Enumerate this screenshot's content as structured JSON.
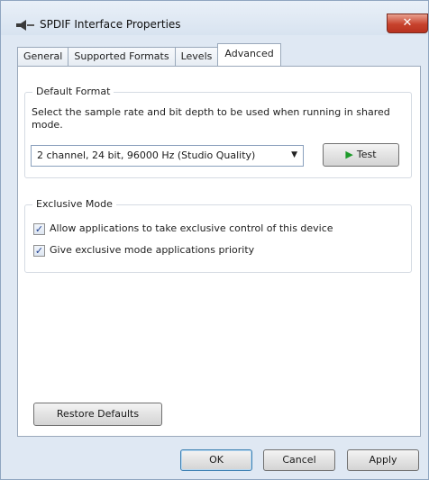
{
  "window": {
    "title": "SPDIF Interface Properties",
    "close_glyph": "✕"
  },
  "tabs": [
    {
      "label": "General",
      "active": false
    },
    {
      "label": "Supported Formats",
      "active": false
    },
    {
      "label": "Levels",
      "active": false
    },
    {
      "label": "Advanced",
      "active": true
    }
  ],
  "default_format": {
    "group_label": "Default Format",
    "description": "Select the sample rate and bit depth to be used when running in shared mode.",
    "selected_format": "2 channel, 24 bit, 96000 Hz (Studio Quality)",
    "test_label": "Test"
  },
  "exclusive_mode": {
    "group_label": "Exclusive Mode",
    "options": [
      {
        "label": "Allow applications to take exclusive control of this device",
        "checked": true
      },
      {
        "label": "Give exclusive mode applications priority",
        "checked": true
      }
    ]
  },
  "restore_defaults_label": "Restore Defaults",
  "footer": {
    "ok_label": "OK",
    "cancel_label": "Cancel",
    "apply_label": "Apply"
  },
  "icons": {
    "app": "speaker-icon",
    "test": "play-icon",
    "dropdown": "chevron-down-icon"
  }
}
